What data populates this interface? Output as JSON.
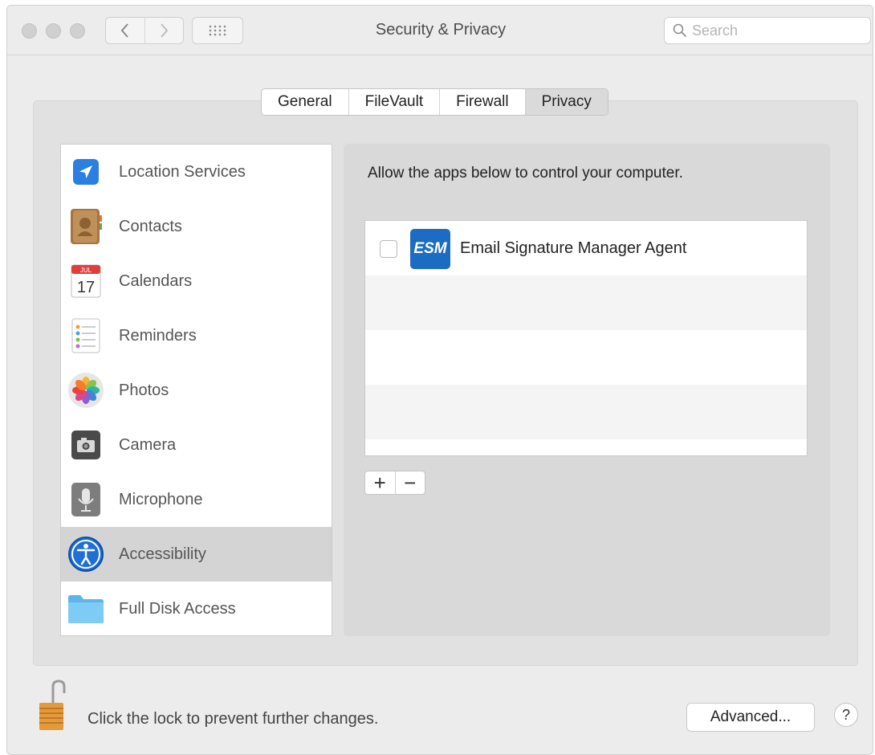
{
  "window": {
    "title": "Security & Privacy"
  },
  "search": {
    "placeholder": "Search"
  },
  "tabs": [
    {
      "label": "General",
      "active": false
    },
    {
      "label": "FileVault",
      "active": false
    },
    {
      "label": "Firewall",
      "active": false
    },
    {
      "label": "Privacy",
      "active": true
    }
  ],
  "sidebar": {
    "items": [
      {
        "label": "Location Services",
        "icon": "location-arrow-icon"
      },
      {
        "label": "Contacts",
        "icon": "contacts-book-icon"
      },
      {
        "label": "Calendars",
        "icon": "calendar-icon",
        "icon_month": "JUL",
        "icon_day": "17"
      },
      {
        "label": "Reminders",
        "icon": "reminders-list-icon"
      },
      {
        "label": "Photos",
        "icon": "photos-flower-icon"
      },
      {
        "label": "Camera",
        "icon": "camera-icon"
      },
      {
        "label": "Microphone",
        "icon": "microphone-icon"
      },
      {
        "label": "Accessibility",
        "icon": "accessibility-icon",
        "selected": true
      },
      {
        "label": "Full Disk Access",
        "icon": "folder-icon"
      }
    ]
  },
  "privacy_panel": {
    "description": "Allow the apps below to control your computer.",
    "apps": [
      {
        "name": "Email Signature Manager Agent",
        "icon_text": "ESM",
        "checked": false
      }
    ],
    "add_label": "+",
    "remove_label": "−"
  },
  "footer": {
    "lock_message": "Click the lock to prevent further changes.",
    "advanced_label": "Advanced...",
    "help_label": "?"
  },
  "colors": {
    "window_bg": "#ececec",
    "panel_bg": "#e1e1e1",
    "selected_row": "#d4d4d4",
    "esm_blue": "#1b6cc2",
    "location_blue": "#2a7fe0"
  }
}
